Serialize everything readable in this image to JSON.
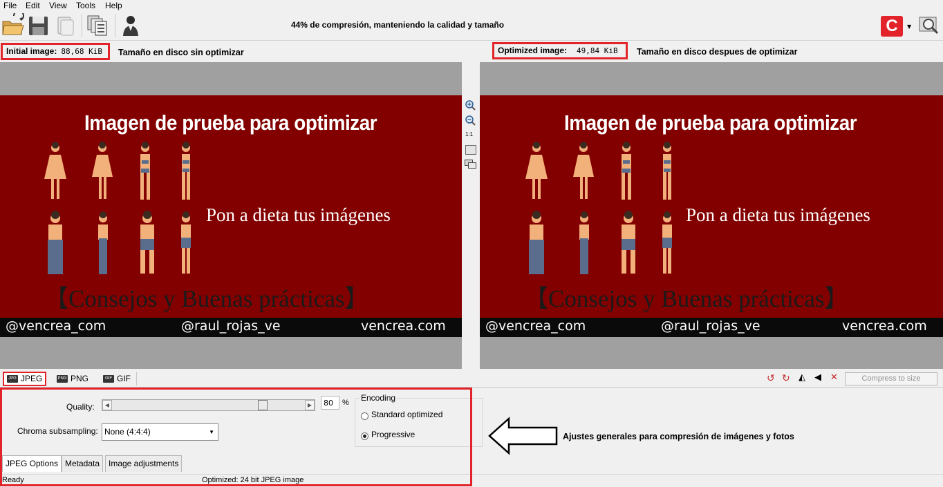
{
  "menu": [
    "File",
    "Edit",
    "View",
    "Tools",
    "Help"
  ],
  "toolbar": {
    "banner": "44% de compresión, manteniendo la calidad y tamaño",
    "brand_letter": "C"
  },
  "initial": {
    "label": "Initial image:",
    "size": "88,68 KiB",
    "note": "Tamaño en disco sin optimizar"
  },
  "optimized": {
    "label": "Optimized image:",
    "size": "49,84 KiB",
    "note": "Tamaño en disco despues de optimizar"
  },
  "preview": {
    "title": "Imagen de prueba para optimizar",
    "subtitle": "Pon a dieta tus imágenes",
    "tips": "【Consejos y Buenas prácticas】",
    "footer_left": "@vencrea_com",
    "footer_mid": "@raul_rojas_ve",
    "footer_right": "vencrea.com"
  },
  "zoom": {
    "one_to_one": "1:1"
  },
  "format_tabs": [
    {
      "label": "JPEG",
      "icon": "JPG"
    },
    {
      "label": "PNG",
      "icon": "PNG"
    },
    {
      "label": "GIF",
      "icon": "GIF"
    }
  ],
  "compress_to_size": "Compress to size",
  "options": {
    "quality_label": "Quality:",
    "quality_value": "80",
    "quality_unit": "%",
    "chroma_label": "Chroma subsampling:",
    "chroma_value": "None (4:4:4)",
    "encoding_label": "Encoding",
    "encoding_options": [
      "Standard optimized",
      "Progressive"
    ],
    "encoding_selected": "Progressive"
  },
  "sub_tabs": [
    "JPEG Options",
    "Metadata",
    "Image adjustments"
  ],
  "annotation": "Ajustes generales para compresión de imágenes y fotos",
  "status": {
    "left": "Ready",
    "right": "Optimized: 24 bit JPEG image"
  },
  "colors": {
    "highlight": "#e3232a",
    "preview_bg": "#830000",
    "brand": "#e3232a"
  }
}
